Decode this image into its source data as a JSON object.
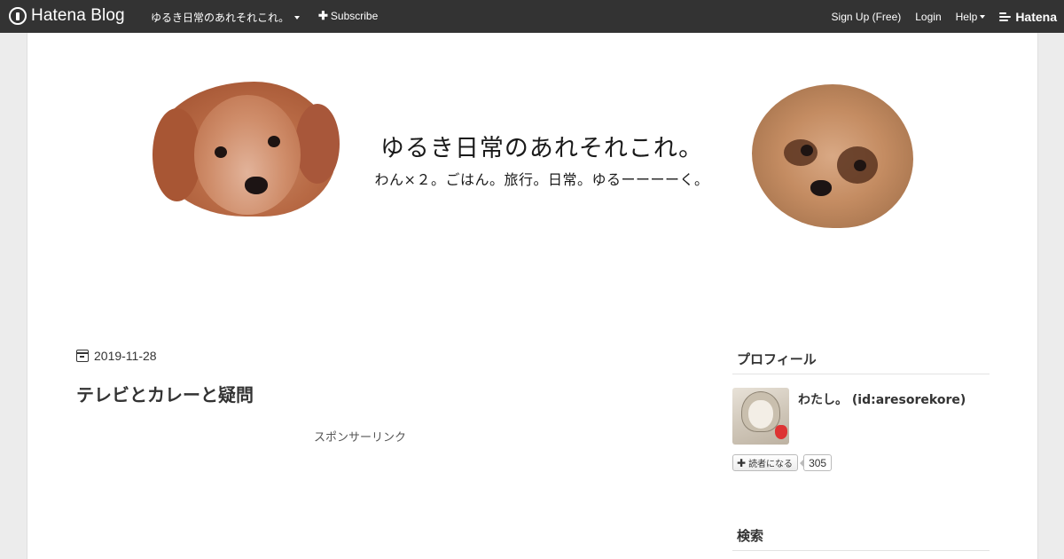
{
  "topbar": {
    "logo_text": "Hatena Blog",
    "blog_name": "ゆるき日常のあれそれこれ。",
    "subscribe_label": "Subscribe",
    "signup_label": "Sign Up (Free)",
    "login_label": "Login",
    "help_label": "Help",
    "hatena_label": "Hatena"
  },
  "header": {
    "title": "ゆるき日常のあれそれこれ。",
    "description": "わん×２。ごはん。旅行。日常。ゆるーーーーく。"
  },
  "entry": {
    "date": "2019-11-28",
    "title": "テレビとカレーと疑問",
    "sponsor_label": "スポンサーリンク"
  },
  "sidebar": {
    "profile_title": "プロフィール",
    "profile_name": "わたし。 (id:aresorekore)",
    "subscribe_button": "読者になる",
    "subscriber_count": "305",
    "search_title": "検索"
  },
  "colors": {
    "topbar_bg": "#333333",
    "page_bg": "#ececec",
    "content_bg": "#ffffff",
    "text": "#333333"
  },
  "icons": [
    "hatena-blog-logo-icon",
    "chevron-down-icon",
    "plus-icon",
    "hatena-logo-icon",
    "calendar-icon"
  ]
}
